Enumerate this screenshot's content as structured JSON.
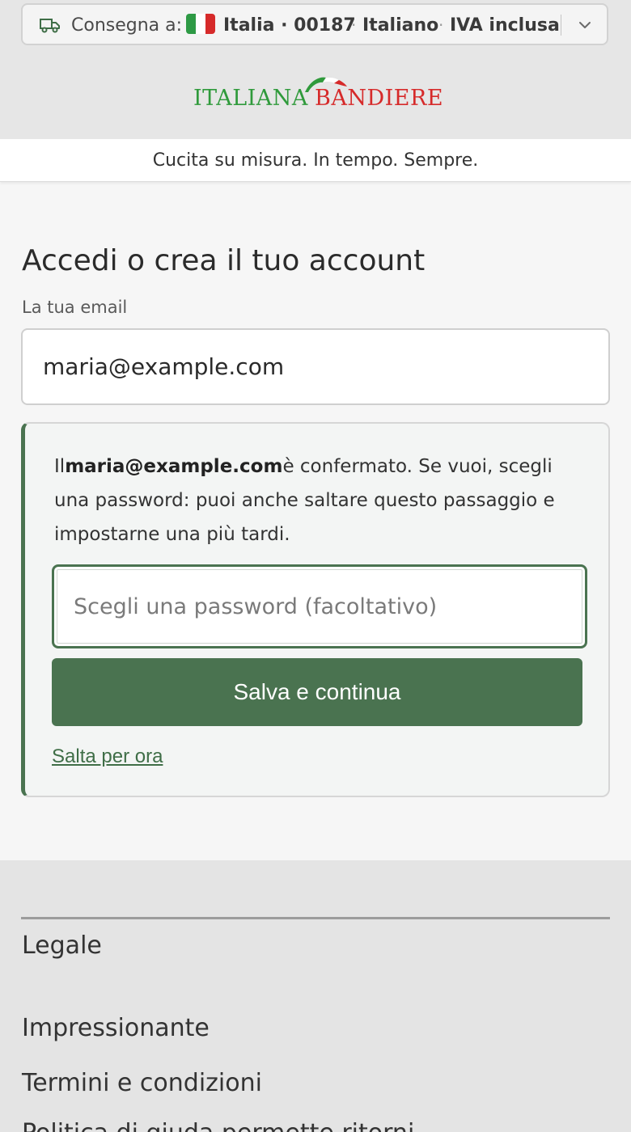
{
  "delivery_bar": {
    "label": "Consegna a:",
    "country": "Italia · 00187",
    "separator": "·",
    "language": "Italiano",
    "vat": "IVA inclusa",
    "flag_colors": [
      "#2e9a45",
      "#ffffff",
      "#d62a2a"
    ],
    "icons": {
      "truck": "truck-icon",
      "chevron": "chevron-down-icon"
    }
  },
  "logo": {
    "left": "ITALIANA",
    "right": "BANDIERE",
    "green": "#2f9a3b",
    "red": "#d62a2a"
  },
  "tagline": "Cucita su misura. In tempo. Sempre.",
  "main": {
    "heading": "Accedi o crea il tuo account",
    "email_label": "La tua email",
    "email_value": "maria@example.com"
  },
  "panel": {
    "text_prefix": "Il",
    "text_email": "maria@example.com",
    "text_suffix": "è confermato. Se vuoi, scegli una password: puoi anche saltare questo passaggio e impostarne una più tardi.",
    "password_placeholder": "Scegli una password (facoltativo)",
    "save_button": "Salva e continua",
    "skip_link": "Salta per ora",
    "accent": "#4a7350"
  },
  "footer": {
    "title": "Legale",
    "links": [
      "Impressionante",
      "Termini e condizioni",
      "Politica di giuda permette ritorni"
    ]
  }
}
